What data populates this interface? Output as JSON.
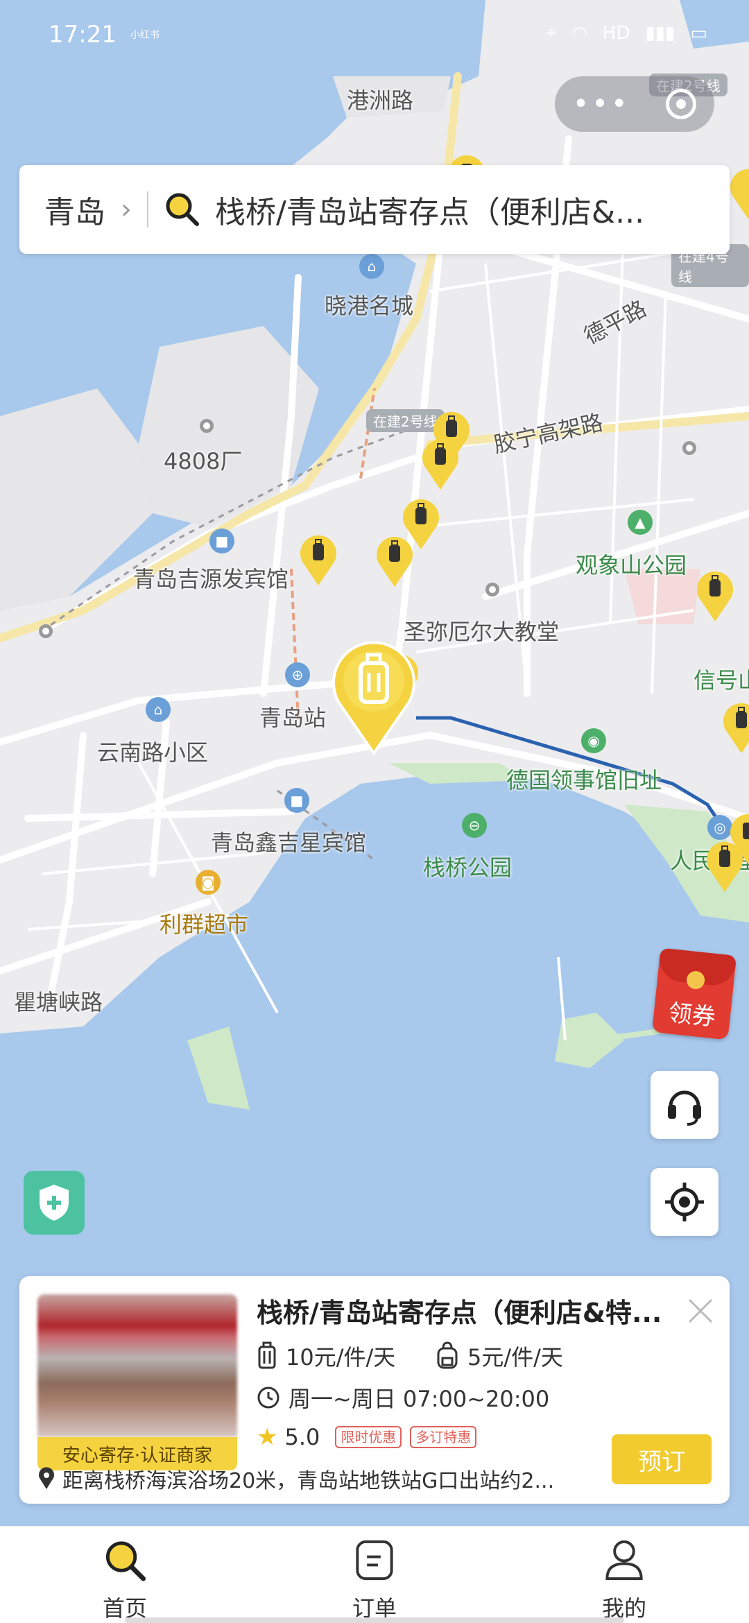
{
  "status_bar": {
    "time": "17:21",
    "app_tag": "小红书",
    "network": "HD"
  },
  "search": {
    "city": "青岛",
    "query": "栈桥/青岛站寄存点（便利店&..."
  },
  "map": {
    "roads": [
      "港洲路",
      "德平路",
      "胶宁高架路",
      "瞿塘峡路"
    ],
    "places": [
      "晓港名城",
      "4808厂",
      "青岛吉源发宾馆",
      "观象山公园",
      "圣弥厄尔大教堂",
      "青岛站",
      "云南路小区",
      "德国领事馆旧址",
      "青岛鑫吉星宾馆",
      "栈桥公园",
      "利群超市",
      "信号山",
      "人民会堂"
    ],
    "metro_tags": [
      "在建2号线",
      "在建2号线",
      "在建4号线"
    ]
  },
  "coupon": {
    "label": "领券"
  },
  "store": {
    "name": "栈桥/青岛站寄存点（便利店&特...",
    "badge": "安心寄存·认证商家",
    "price_luggage": "10元/件/天",
    "price_bag": "5元/件/天",
    "hours": "周一~周日 07:00~20:00",
    "rating": "5.0",
    "tags": [
      "限时优惠",
      "多订特惠"
    ],
    "address": "距离栈桥海滨浴场20米，青岛站地铁站G口出站约2...",
    "book_label": "预订"
  },
  "tabs": [
    {
      "label": "首页",
      "icon": "search-icon",
      "active": true
    },
    {
      "label": "订单",
      "icon": "order-icon",
      "active": false
    },
    {
      "label": "我的",
      "icon": "user-icon",
      "active": false
    }
  ],
  "colors": {
    "water": "#a8c8ec",
    "accent": "#f2cb2f",
    "marker": "#f5d23f"
  }
}
